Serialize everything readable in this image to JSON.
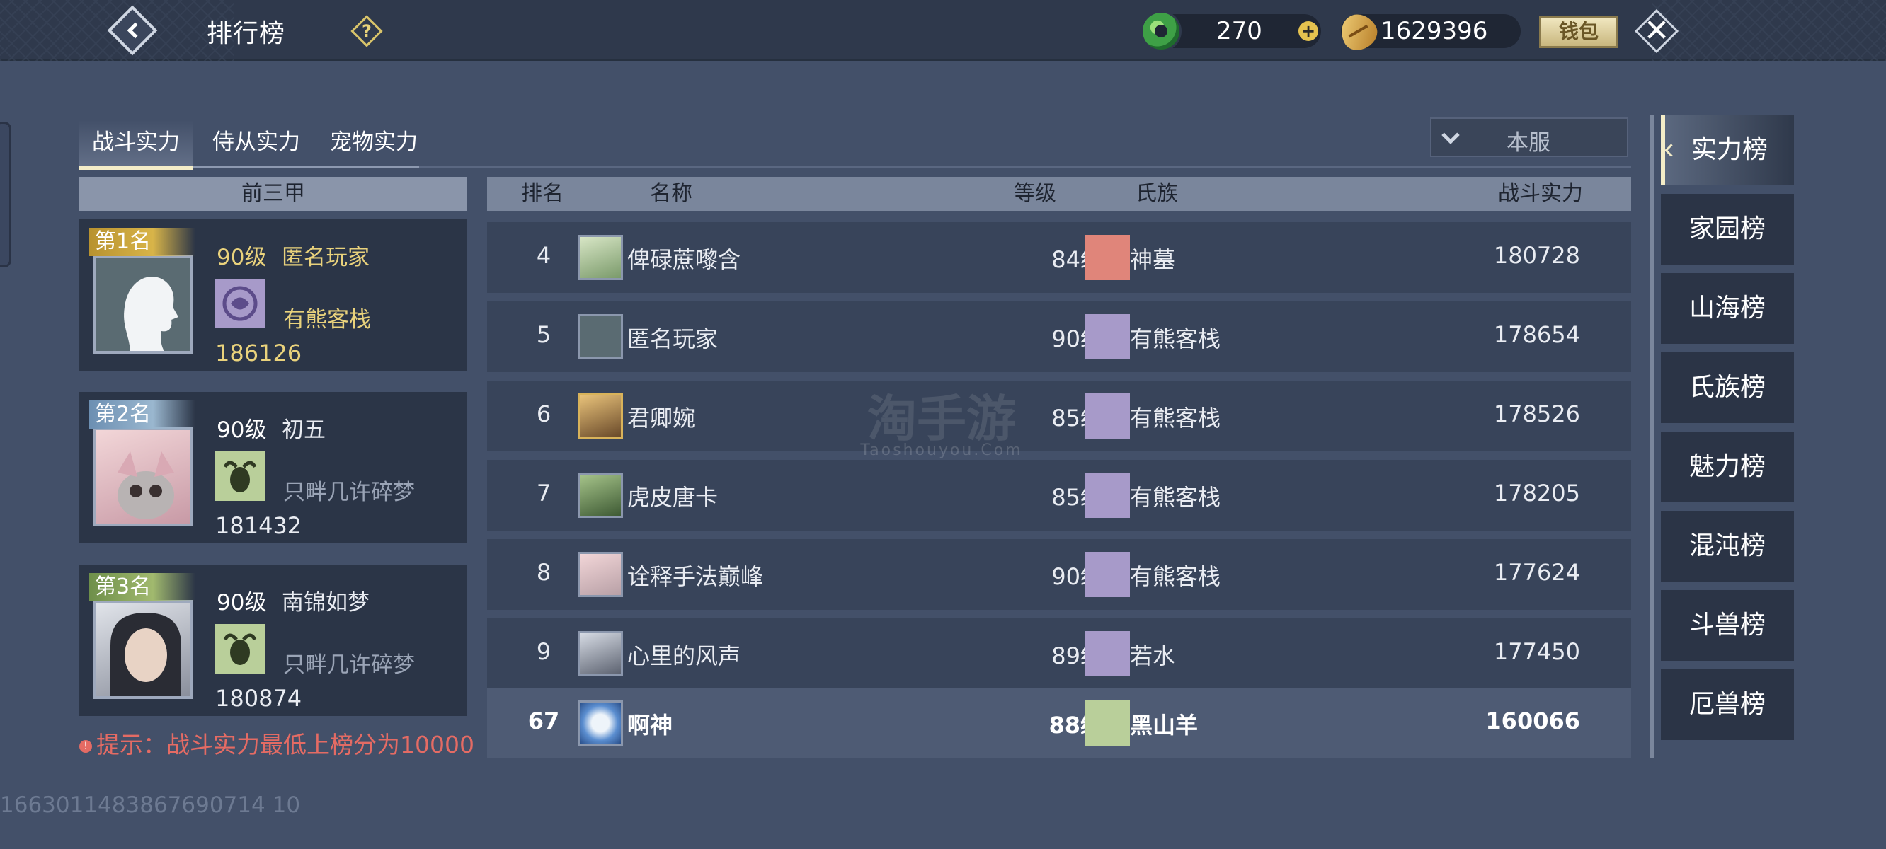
{
  "header": {
    "title": "排行榜",
    "help_symbol": "?",
    "jade_amount": "270",
    "plus_symbol": "+",
    "coin_amount": "1629396",
    "wallet_label": "钱包",
    "close_symbol": "✕"
  },
  "tabs": [
    {
      "label": "战斗实力",
      "active": true
    },
    {
      "label": "侍从实力",
      "active": false
    },
    {
      "label": "宠物实力",
      "active": false
    }
  ],
  "server_filter": {
    "value": "本服"
  },
  "top3": {
    "header": "前三甲",
    "entries": [
      {
        "rank_label": "第1名",
        "level": "90级",
        "name": "匿名玩家",
        "clan": "有熊客栈",
        "power": "186126"
      },
      {
        "rank_label": "第2名",
        "level": "90级",
        "name": "初五",
        "clan": "只畔几许碎梦",
        "power": "181432"
      },
      {
        "rank_label": "第3名",
        "level": "90级",
        "name": "南锦如梦",
        "clan": "只畔几许碎梦",
        "power": "180874"
      }
    ]
  },
  "tip": {
    "icon": "!",
    "text": "提示：战斗实力最低上榜分为10000"
  },
  "ranking": {
    "columns": {
      "rank": "排名",
      "name": "名称",
      "level": "等级",
      "clan": "氏族",
      "power": "战斗实力"
    },
    "rows": [
      {
        "rank": "4",
        "name": "俾碌蔗嚟含",
        "level": "84级",
        "clan": "神墓",
        "power": "180728"
      },
      {
        "rank": "5",
        "name": "匿名玩家",
        "level": "90级",
        "clan": "有熊客栈",
        "power": "178654"
      },
      {
        "rank": "6",
        "name": "君卿婉",
        "level": "85级",
        "clan": "有熊客栈",
        "power": "178526"
      },
      {
        "rank": "7",
        "name": "虎皮唐卡",
        "level": "85级",
        "clan": "有熊客栈",
        "power": "178205"
      },
      {
        "rank": "8",
        "name": "诠释手法巅峰",
        "level": "90级",
        "clan": "有熊客栈",
        "power": "177624"
      },
      {
        "rank": "9",
        "name": "心里的风声",
        "level": "89级",
        "clan": "若水",
        "power": "177450"
      }
    ],
    "my_row": {
      "rank": "67",
      "name": "啊神",
      "level": "88级",
      "clan": "黑山羊",
      "power": "160066"
    }
  },
  "sidebar": [
    {
      "label": "实力榜",
      "active": true
    },
    {
      "label": "家园榜",
      "active": false
    },
    {
      "label": "山海榜",
      "active": false
    },
    {
      "label": "氏族榜",
      "active": false
    },
    {
      "label": "魅力榜",
      "active": false
    },
    {
      "label": "混沌榜",
      "active": false
    },
    {
      "label": "斗兽榜",
      "active": false
    },
    {
      "label": "厄兽榜",
      "active": false
    }
  ],
  "watermark": {
    "text": "淘手游",
    "sub": "Taoshouyou.Com"
  },
  "user_id": "1663011483867690714 10"
}
